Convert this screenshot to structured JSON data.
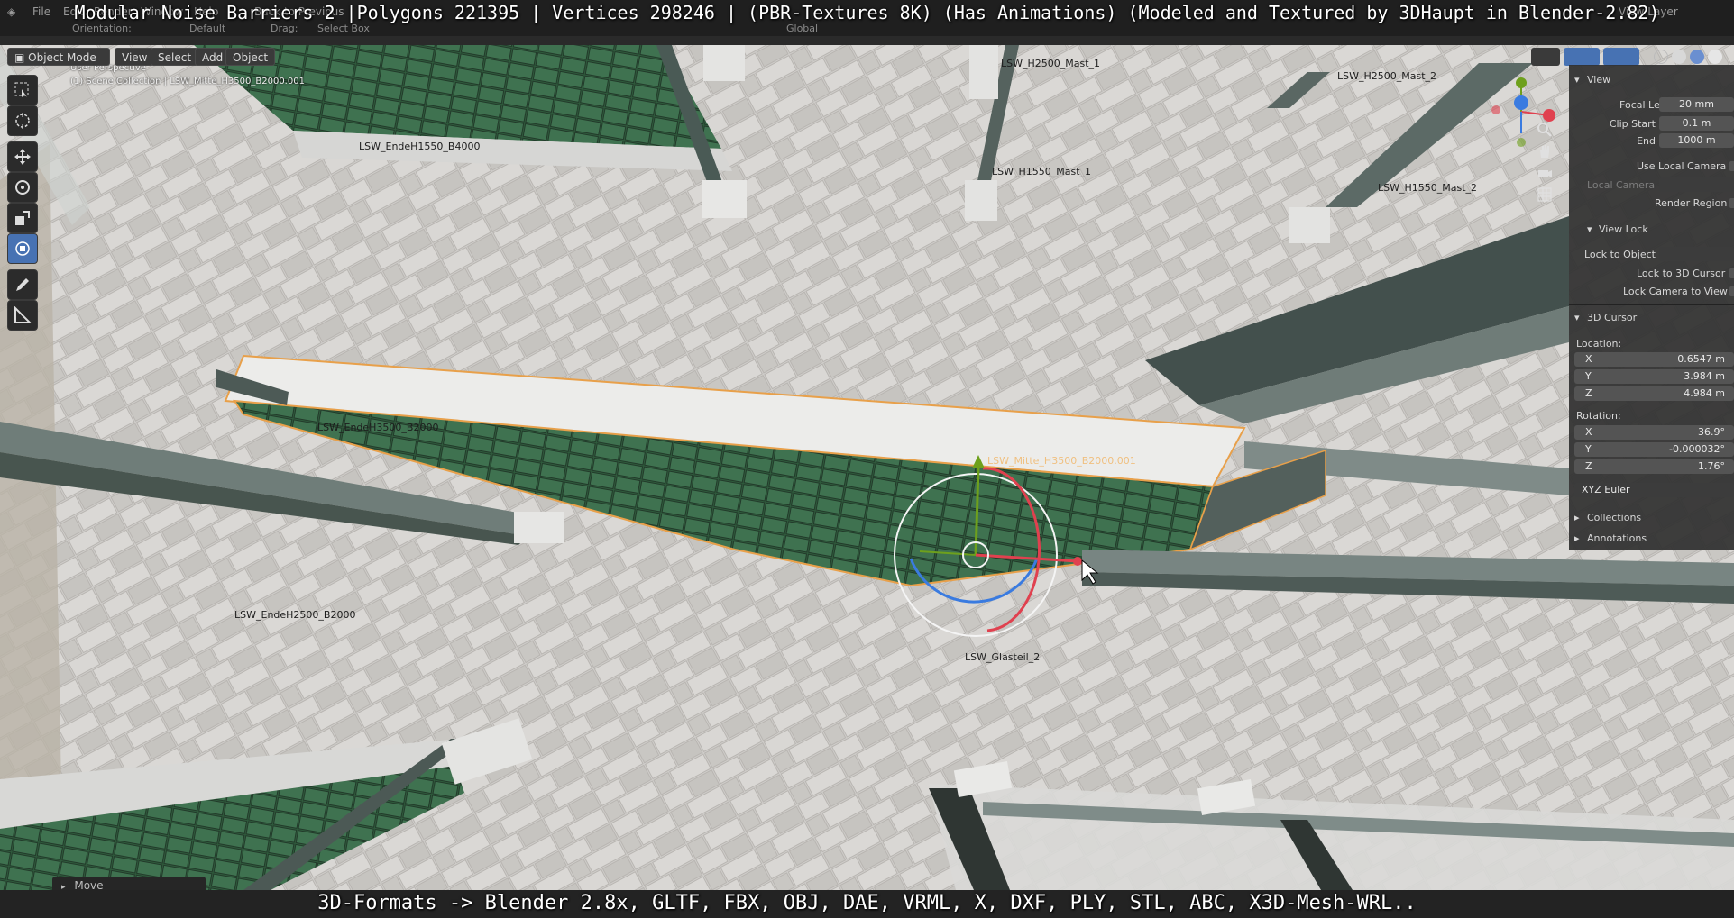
{
  "overlay": {
    "title": "Modular Noise Barriers 2 |Polygons 221395 | Vertices 298246 | (PBR-Textures 8K) (Has Animations) (Modeled and Textured by 3DHaupt in Blender-2.82)",
    "bottom": "3D-Formats -> Blender 2.8x, GLTF, FBX, OBJ, DAE, VRML, X, DXF, PLY, STL, ABC, X3D-Mesh-WRL.."
  },
  "menubar": {
    "items": [
      "File",
      "Edit",
      "Render",
      "Window",
      "Help"
    ],
    "back_to_previous": "Back to Previous",
    "view_layer": "View Layer"
  },
  "header": {
    "orientation_label": "Orientation:",
    "orientation_value": "Default",
    "drag_label": "Drag:",
    "drag_value": "Select Box",
    "transform_space": "Global",
    "mode": "Object Mode",
    "menus": [
      "View",
      "Select",
      "Add",
      "Object"
    ]
  },
  "viewport": {
    "perspective": "User Perspective",
    "collection": "(1) Scene Collection | LSW_Mitte_H3500_B2000.001",
    "objects": {
      "h2500_mast_1": "LSW_H2500_Mast_1",
      "h2500_mast_2": "LSW_H2500_Mast_2",
      "ende_h1550_b4000": "LSW_EndeH1550_B4000",
      "h1550_mast_1": "LSW_H1550_Mast_1",
      "h1550_mast_2": "LSW_H1550_Mast_2",
      "ende_h3500_b2000": "LSW_EndeH3500_B2000",
      "mitte_selected": "LSW_Mitte_H3500_B2000.001",
      "ende_h2500_b2000": "LSW_EndeH2500_B2000",
      "glasteil_2": "LSW_Glasteil_2"
    },
    "last_operator": "Move"
  },
  "npanel": {
    "view_section": "View",
    "focal_length_label": "Focal Length",
    "focal_length": "20 mm",
    "clip_start_label": "Clip Start",
    "clip_start": "0.1 m",
    "clip_end_label": "End",
    "clip_end": "1000 m",
    "use_local_camera": "Use Local Camera",
    "local_camera": "Local Camera",
    "render_region": "Render Region",
    "view_lock_section": "View Lock",
    "lock_to_object": "Lock to Object",
    "lock_to_3d_cursor": "Lock to 3D Cursor",
    "lock_camera_to_view": "Lock Camera to View",
    "cursor_section": "3D Cursor",
    "location_label": "Location:",
    "loc_x_label": "X",
    "loc_x": "0.6547 m",
    "loc_y_label": "Y",
    "loc_y": "3.984 m",
    "loc_z_label": "Z",
    "loc_z": "4.984 m",
    "rotation_label": "Rotation:",
    "rot_x_label": "X",
    "rot_x": "36.9°",
    "rot_y_label": "Y",
    "rot_y": "-0.000032°",
    "rot_z_label": "Z",
    "rot_z": "1.76°",
    "rotation_mode": "XYZ Euler",
    "collections_section": "Collections",
    "annotations_section": "Annotations"
  },
  "colors": {
    "selection_orange": "#e8a04a",
    "active_tool_blue": "#4772b3",
    "gizmo_x": "#e0414f",
    "gizmo_y": "#6ea01c",
    "gizmo_z": "#3a7be0"
  }
}
